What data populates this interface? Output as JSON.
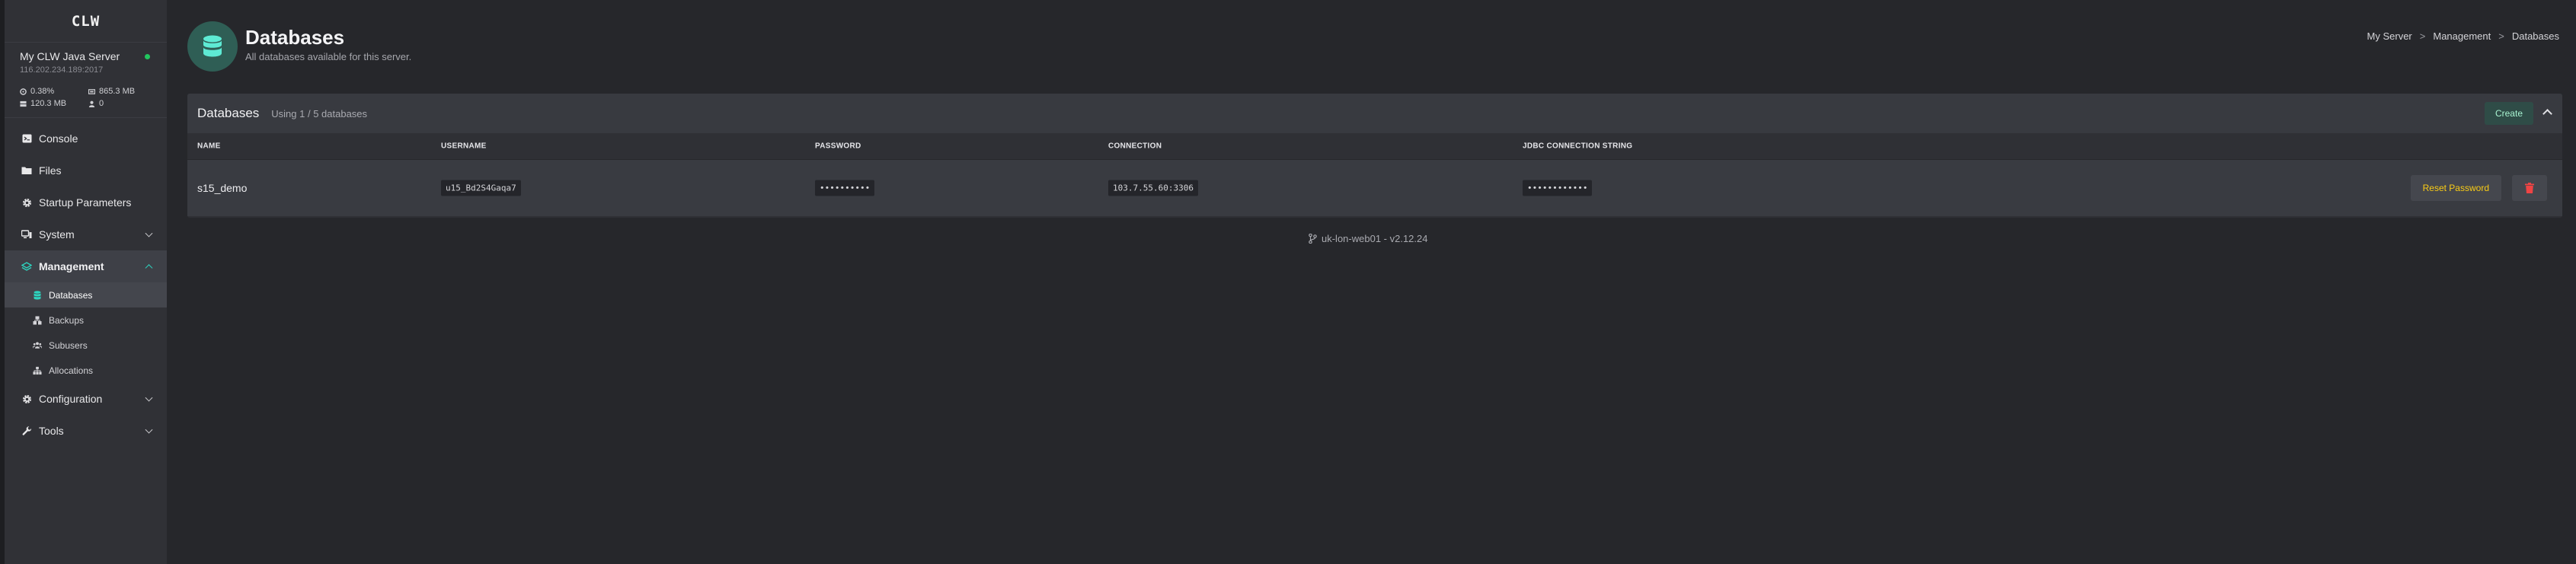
{
  "brand": {
    "logo_text": "CLW"
  },
  "server": {
    "name": "My CLW Java Server",
    "ip": "116.202.234.189:2017",
    "status_color": "#22c55e",
    "stats": {
      "cpu": "0.38%",
      "memory": "865.3 MB",
      "disk": "120.3 MB",
      "players": "0"
    }
  },
  "sidebar": {
    "items": [
      {
        "label": "Console",
        "icon": "terminal-icon"
      },
      {
        "label": "Files",
        "icon": "folder-icon"
      },
      {
        "label": "Startup Parameters",
        "icon": "gear-icon"
      },
      {
        "label": "System",
        "icon": "system-icon"
      },
      {
        "label": "Management",
        "icon": "layers-icon"
      },
      {
        "label": "Configuration",
        "icon": "gear-icon"
      },
      {
        "label": "Tools",
        "icon": "wrench-icon"
      }
    ],
    "management_sub": [
      {
        "label": "Databases",
        "icon": "database-icon"
      },
      {
        "label": "Backups",
        "icon": "backup-icon"
      },
      {
        "label": "Subusers",
        "icon": "users-icon"
      },
      {
        "label": "Allocations",
        "icon": "network-icon"
      }
    ]
  },
  "header": {
    "title": "Databases",
    "subtitle": "All databases available for this server."
  },
  "breadcrumb": {
    "items": [
      "My Server",
      "Management",
      "Databases"
    ],
    "separator": ">"
  },
  "panel": {
    "title": "Databases",
    "usage": "Using 1 / 5 databases",
    "create_label": "Create"
  },
  "table": {
    "columns": [
      "NAME",
      "USERNAME",
      "PASSWORD",
      "CONNECTION",
      "JDBC CONNECTION STRING"
    ],
    "rows": [
      {
        "name": "s15_demo",
        "username": "u15_Bd2S4Gaqa7",
        "password": "••••••••••",
        "connection": "103.7.55.60:3306",
        "jdbc": "••••••••••••"
      }
    ],
    "reset_label": "Reset Password"
  },
  "footer": {
    "text": "uk-lon-web01 - v2.12.24"
  },
  "colors": {
    "accent": "#2dd4bf",
    "warning": "#facc15",
    "danger": "#ef4444"
  }
}
